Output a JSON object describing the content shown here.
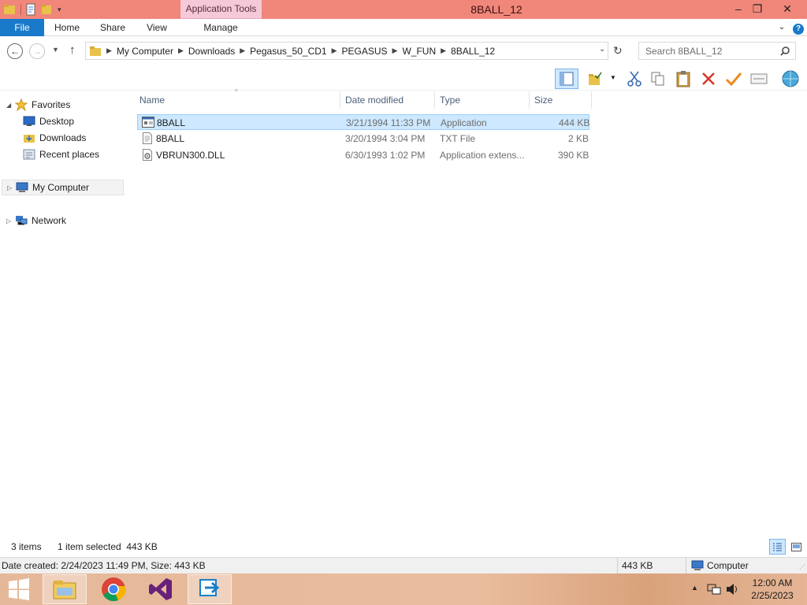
{
  "window": {
    "title": "8BALL_12",
    "context_tab_group": "Application Tools",
    "buttons": {
      "minimize": "‒",
      "maximize": "❐",
      "close": "✕"
    }
  },
  "ribbon": {
    "tabs": [
      "File",
      "Home",
      "Share",
      "View",
      "Manage"
    ],
    "help": "?"
  },
  "address": {
    "crumbs": [
      "My Computer",
      "Downloads",
      "Pegasus_50_CD1",
      "PEGASUS",
      "W_FUN",
      "8BALL_12"
    ],
    "search_placeholder": "Search 8BALL_12"
  },
  "nav": {
    "favorites": "Favorites",
    "desktop": "Desktop",
    "downloads": "Downloads",
    "recent": "Recent places",
    "computer": "My Computer",
    "network": "Network"
  },
  "columns": [
    "Name",
    "Date modified",
    "Type",
    "Size"
  ],
  "files": [
    {
      "name": "8BALL",
      "date": "3/21/1994 11:33 PM",
      "type": "Application",
      "size": "444 KB",
      "icon": "application-icon",
      "selected": true
    },
    {
      "name": "8BALL",
      "date": "3/20/1994 3:04 PM",
      "type": "TXT File",
      "size": "2 KB",
      "icon": "text-file-icon",
      "selected": false
    },
    {
      "name": "VBRUN300.DLL",
      "date": "6/30/1993 1:02 PM",
      "type": "Application extens...",
      "size": "390 KB",
      "icon": "dll-file-icon",
      "selected": false
    }
  ],
  "status": {
    "count": "3 items",
    "selected": "1 item selected  443 KB"
  },
  "details": {
    "info": "Date created: 2/24/2023 11:49 PM, Size: 443 KB",
    "size": "443 KB",
    "location": "Computer"
  },
  "taskbar": {
    "apps": [
      "file-explorer",
      "chrome",
      "visual-studio",
      "remote-app"
    ],
    "time": "12:00 AM",
    "date": "2/25/2023"
  },
  "colors": {
    "titlebar": "#f0877a",
    "file_tab": "#1979ca",
    "selection": "#cde8ff"
  }
}
